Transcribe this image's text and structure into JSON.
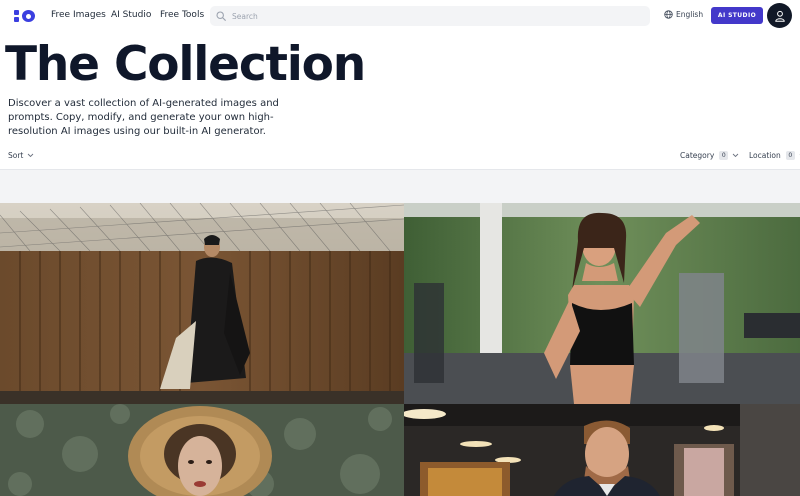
{
  "nav": {
    "links": [
      "Free Images",
      "AI Studio",
      "Free Tools"
    ],
    "search_placeholder": "Search",
    "language": "English",
    "studio_button": "AI STUDIO"
  },
  "hero": {
    "title": "The Collection",
    "subtitle": "Discover a vast collection of AI-generated images and prompts. Copy, modify, and generate your own high-resolution AI images using our built-in AI generator."
  },
  "filters": {
    "sort_label": "Sort",
    "category_label": "Category",
    "category_count": "0",
    "location_label": "Location",
    "location_count": "0"
  },
  "colors": {
    "accent": "#4338ca",
    "logo": "#3b3fe0",
    "title": "#0f172a"
  },
  "icons": [
    "logo-icon",
    "search-icon",
    "globe-icon",
    "user-icon",
    "chevron-down-icon"
  ],
  "gallery": [
    "man-in-black-coat-against-wooden-fence",
    "smiling-woman-in-gym",
    "woman-in-wide-straw-hat",
    "man-in-suit-in-office"
  ]
}
